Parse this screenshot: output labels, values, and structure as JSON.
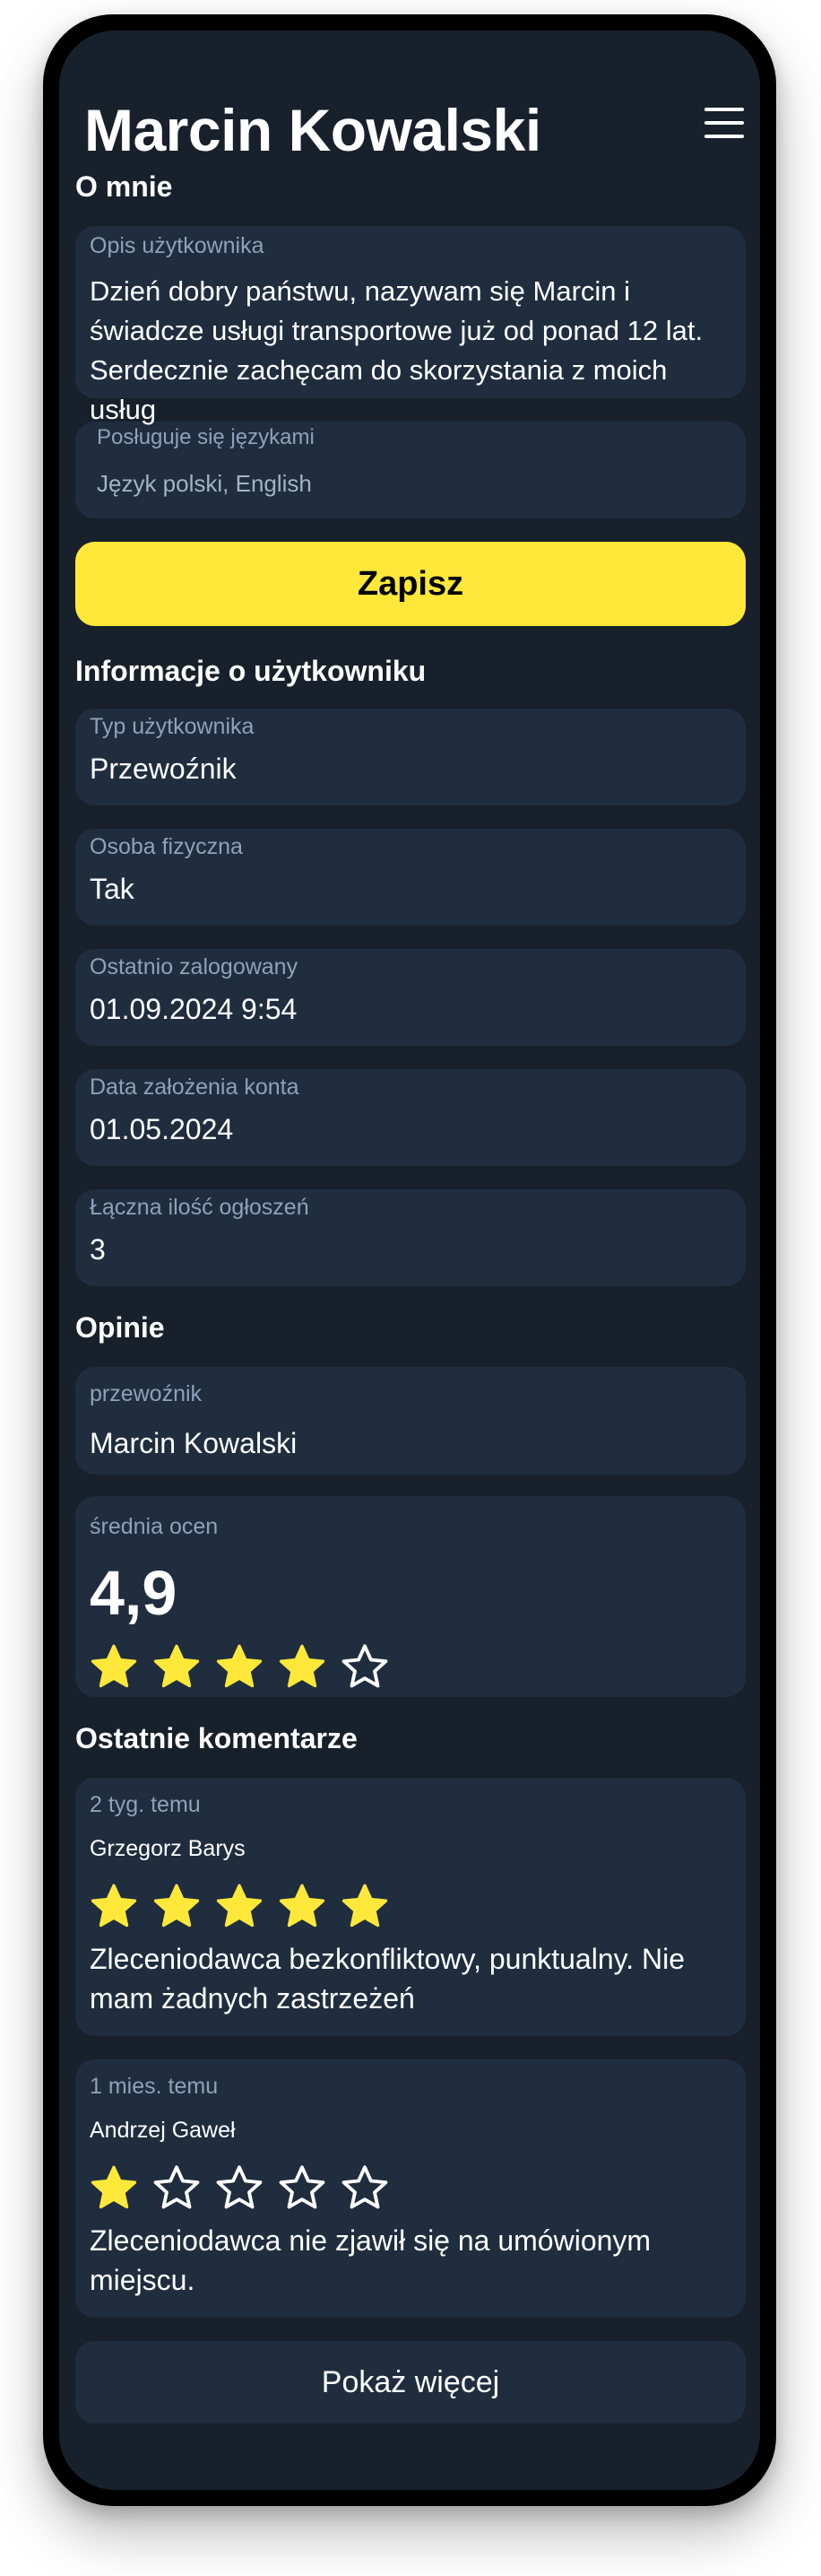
{
  "profile": {
    "name": "Marcin Kowalski"
  },
  "about": {
    "section_title": "O mnie",
    "description_label": "Opis użytkownika",
    "description": "Dzień dobry państwu, nazywam się Marcin i świadcze usługi transportowe już od ponad 12 lat. Serdecznie zachęcam do skorzystania z moich usług",
    "languages_label": "Posługuje się językami",
    "languages": "Język polski, English",
    "save_label": "Zapisz"
  },
  "info": {
    "section_title": "Informacje o użytkowniku",
    "fields": [
      {
        "label": "Typ użytkownika",
        "value": "Przewoźnik"
      },
      {
        "label": "Osoba fizyczna",
        "value": "Tak"
      },
      {
        "label": "Ostatnio zalogowany",
        "value": "01.09.2024 9:54"
      },
      {
        "label": "Data założenia konta",
        "value": "01.05.2024"
      },
      {
        "label": "Łączna ilość ogłoszeń",
        "value": "3"
      }
    ]
  },
  "reviews": {
    "section_title": "Opinie",
    "carrier_label": "przewoźnik",
    "carrier_name": "Marcin Kowalski",
    "average_label": "średnia ocen",
    "average_value": "4,9",
    "average_stars_filled": 4,
    "comments_title": "Ostatnie komentarze",
    "comments": [
      {
        "date": "2 tyg. temu",
        "author": "Grzegorz Barys",
        "stars_filled": 5,
        "text": "Zleceniodawca bezkonfliktowy, punktualny. Nie mam żadnych zastrzeżeń"
      },
      {
        "date": "1 mies. temu",
        "author": "Andrzej Gaweł",
        "stars_filled": 1,
        "text": "Zleceniodawca nie zjawił się na umówionym miejscu."
      }
    ],
    "show_more_label": "Pokaż więcej",
    "star_color": "#ffe839"
  },
  "icons": {
    "menu": "hamburger-menu-icon",
    "star_filled": "star-filled-icon",
    "star_empty": "star-outline-icon"
  }
}
